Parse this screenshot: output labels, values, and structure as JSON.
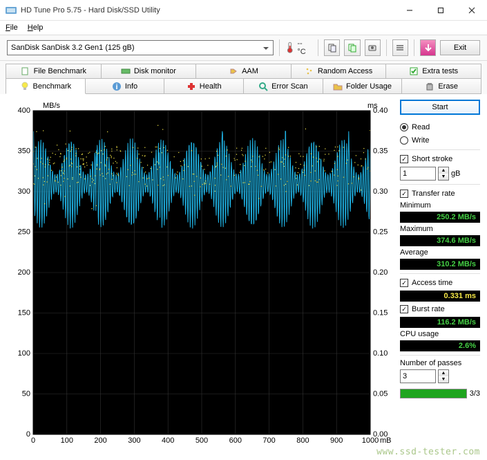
{
  "window": {
    "title": "HD Tune Pro 5.75 - Hard Disk/SSD Utility",
    "menu": {
      "file": "File",
      "help": "Help"
    }
  },
  "toolbar": {
    "device": "SanDisk SanDisk 3.2 Gen1 (125 gB)",
    "temp": "-- °C",
    "exit": "Exit"
  },
  "tabs": {
    "top": [
      {
        "label": "File Benchmark"
      },
      {
        "label": "Disk monitor"
      },
      {
        "label": "AAM"
      },
      {
        "label": "Random Access"
      },
      {
        "label": "Extra tests"
      }
    ],
    "bottom": [
      {
        "label": "Benchmark"
      },
      {
        "label": "Info"
      },
      {
        "label": "Health"
      },
      {
        "label": "Error Scan"
      },
      {
        "label": "Folder Usage"
      },
      {
        "label": "Erase"
      }
    ]
  },
  "controls": {
    "start": "Start",
    "read": "Read",
    "write": "Write",
    "short_stroke": "Short stroke",
    "short_stroke_value": "1",
    "short_stroke_unit": "gB",
    "transfer_rate": "Transfer rate",
    "minimum_label": "Minimum",
    "minimum_value": "250.2 MB/s",
    "maximum_label": "Maximum",
    "maximum_value": "374.6 MB/s",
    "average_label": "Average",
    "average_value": "310.2 MB/s",
    "access_label": "Access time",
    "access_value": "0.331 ms",
    "burst_label": "Burst rate",
    "burst_value": "116.2 MB/s",
    "cpu_label": "CPU usage",
    "cpu_value": "2.6%",
    "passes_label": "Number of passes",
    "passes_value": "3",
    "progress_text": "3/3"
  },
  "chart": {
    "y_left_label": "MB/s",
    "y_right_label": "ms",
    "x_unit": "mB"
  },
  "watermark": "www.ssd-tester.com",
  "chart_data": {
    "type": "line",
    "title": "",
    "x_unit": "mB",
    "xlim": [
      0,
      1000
    ],
    "y_left": {
      "label": "MB/s",
      "lim": [
        0,
        400
      ],
      "ticks": [
        0,
        50,
        100,
        150,
        200,
        250,
        300,
        350,
        400
      ]
    },
    "y_right": {
      "label": "ms",
      "lim": [
        0,
        0.4
      ],
      "ticks": [
        0,
        0.05,
        0.1,
        0.15,
        0.2,
        0.25,
        0.3,
        0.35,
        0.4
      ]
    },
    "x_ticks": [
      0,
      100,
      200,
      300,
      400,
      500,
      600,
      700,
      800,
      900,
      1000
    ],
    "series": [
      {
        "name": "Transfer rate",
        "axis": "left",
        "color": "#1fa6d6",
        "summary": {
          "min": 250.2,
          "max": 374.6,
          "avg": 310.2
        },
        "note": "dense oscillation roughly between 255 and 350 MB/s across full 0–1000 mB range; occasional spikes to ~375"
      },
      {
        "name": "Access time",
        "axis": "right",
        "color": "#f7e948",
        "summary": {
          "avg_ms": 0.331
        },
        "note": "scatter mostly concentrated between 0.27 and 0.35 ms (denoted as ~300–350 band visually), heavier density in first ~250 mB, sparser after"
      }
    ]
  }
}
